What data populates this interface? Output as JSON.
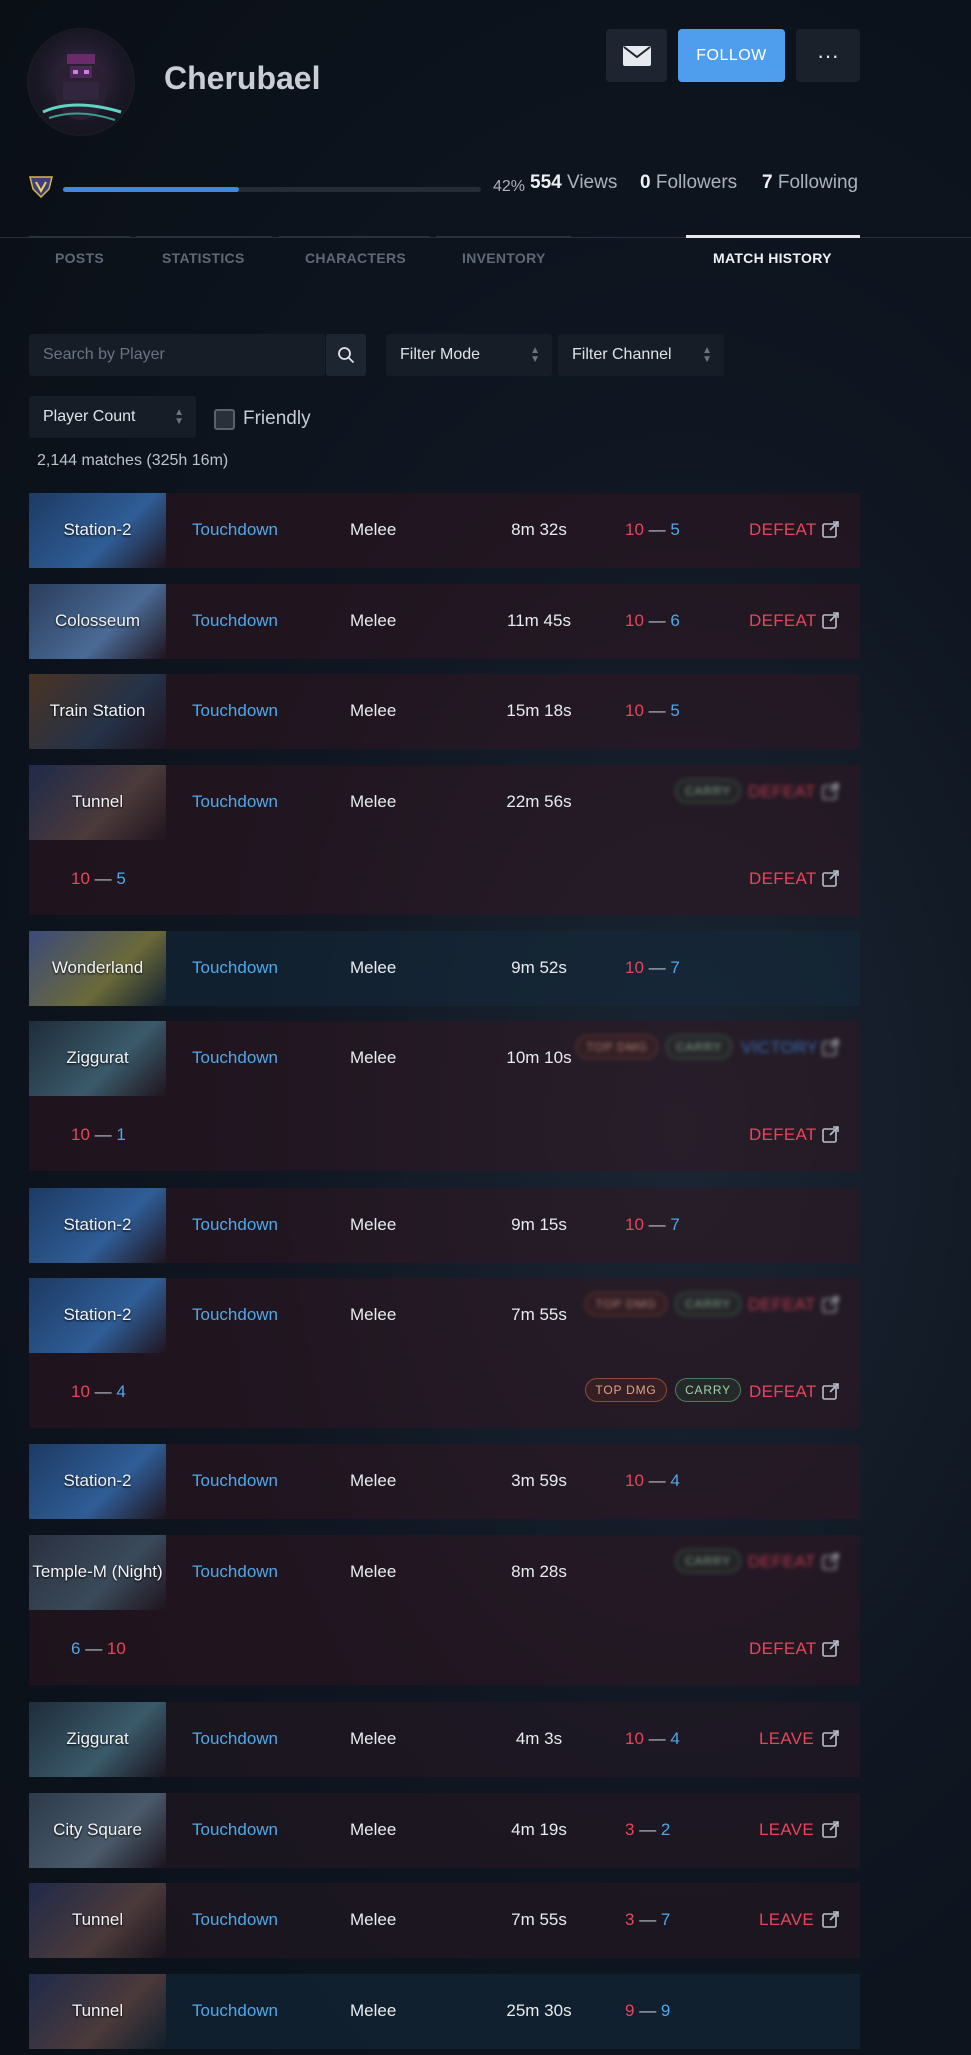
{
  "profile": {
    "username": "Cherubael",
    "level_progress": 0.42,
    "level_pct_label": "42%",
    "views_count": "554",
    "views_label": "Views",
    "followers_count": "0",
    "followers_label": "Followers",
    "following_count": "7",
    "following_label": "Following",
    "follow_label": "FOLLOW",
    "more_label": "···"
  },
  "tabs": [
    "POSTS",
    "STATISTICS",
    "CHARACTERS",
    "INVENTORY",
    "MATCH HISTORY"
  ],
  "filters": {
    "search_placeholder": "Search by Player",
    "mode_label": "Filter Mode",
    "channel_label": "Filter Channel",
    "player_count_label": "Player Count",
    "friendly_label": "Friendly"
  },
  "summary": "2,144 matches (325h 16m)",
  "colors": {
    "accent": "#4f9eee",
    "loss": "#e8455a",
    "blue": "#4fa8e8"
  },
  "matches": [
    {
      "map": "Station-2",
      "mode": "Touchdown",
      "category": "Melee",
      "duration": "8m 32s",
      "score_a": "10",
      "score_b": "5",
      "result": "DEFEAT"
    },
    {
      "map": "Colosseum",
      "mode": "Touchdown",
      "category": "Melee",
      "duration": "11m 45s",
      "score_a": "10",
      "score_b": "6",
      "result": "DEFEAT"
    },
    {
      "map": "Train Station",
      "mode": "Touchdown",
      "category": "Melee",
      "duration": "15m 18s",
      "score_a": "10",
      "score_b": "5",
      "result": ""
    },
    {
      "map": "Tunnel",
      "mode": "Touchdown",
      "category": "Melee",
      "duration": "22m 56s",
      "score_a": "10",
      "score_b": "5",
      "result": "DEFEAT",
      "badges": [
        "CARRY"
      ],
      "ghost_result": "DEFEAT"
    },
    {
      "map": "Wonderland",
      "mode": "Touchdown",
      "category": "Melee",
      "duration": "9m 52s",
      "score_a": "10",
      "score_b": "7",
      "result": ""
    },
    {
      "map": "Ziggurat",
      "mode": "Touchdown",
      "category": "Melee",
      "duration": "10m 10s",
      "score_a": "10",
      "score_b": "1",
      "result": "DEFEAT",
      "badges": [
        "TOP DMG",
        "CARRY"
      ],
      "ghost_result": "VICTORY"
    },
    {
      "map": "Station-2",
      "mode": "Touchdown",
      "category": "Melee",
      "duration": "9m 15s",
      "score_a": "10",
      "score_b": "7",
      "result": ""
    },
    {
      "map": "Station-2",
      "mode": "Touchdown",
      "category": "Melee",
      "duration": "7m 55s",
      "score_a": "10",
      "score_b": "4",
      "result": "DEFEAT",
      "badges": [
        "TOP DMG",
        "CARRY"
      ],
      "ghost_result": "DEFEAT"
    },
    {
      "map": "Station-2",
      "mode": "Touchdown",
      "category": "Melee",
      "duration": "3m 59s",
      "score_a": "10",
      "score_b": "4",
      "result": ""
    },
    {
      "map": "Temple-M (Night)",
      "mode": "Touchdown",
      "category": "Melee",
      "duration": "8m 28s",
      "score_a": "6",
      "score_b": "10",
      "result": "DEFEAT",
      "badges": [
        "CARRY"
      ],
      "ghost_result": "DEFEAT"
    },
    {
      "map": "Ziggurat",
      "mode": "Touchdown",
      "category": "Melee",
      "duration": "4m 3s",
      "score_a": "10",
      "score_b": "4",
      "result": "LEAVE"
    },
    {
      "map": "City Square",
      "mode": "Touchdown",
      "category": "Melee",
      "duration": "4m 19s",
      "score_a": "3",
      "score_b": "2",
      "result": "LEAVE"
    },
    {
      "map": "Tunnel",
      "mode": "Touchdown",
      "category": "Melee",
      "duration": "7m 55s",
      "score_a": "3",
      "score_b": "7",
      "result": "LEAVE"
    },
    {
      "map": "Tunnel",
      "mode": "Touchdown",
      "category": "Melee",
      "duration": "25m 30s",
      "score_a": "9",
      "score_b": "9",
      "result": ""
    }
  ]
}
